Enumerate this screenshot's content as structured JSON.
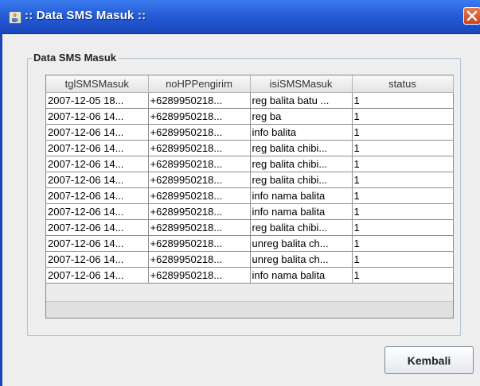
{
  "window": {
    "title": ":: Data SMS Masuk ::",
    "colors": {
      "titlebar": "#2a5fd8",
      "close_button": "#d9532c",
      "background": "#eeeeee"
    }
  },
  "group": {
    "label": "Data SMS Masuk"
  },
  "table": {
    "columns": [
      "tglSMSMasuk",
      "noHPPengirim",
      "isiSMSMasuk",
      "status"
    ],
    "rows": [
      [
        "2007-12-05 18...",
        "+6289950218...",
        "reg balita batu ...",
        "1"
      ],
      [
        "2007-12-06 14...",
        "+6289950218...",
        "reg ba",
        "1"
      ],
      [
        "2007-12-06 14...",
        "+6289950218...",
        "info balita",
        "1"
      ],
      [
        "2007-12-06 14...",
        "+6289950218...",
        "reg balita chibi...",
        "1"
      ],
      [
        "2007-12-06 14...",
        "+6289950218...",
        "reg balita chibi...",
        "1"
      ],
      [
        "2007-12-06 14...",
        "+6289950218...",
        "reg balita chibi...",
        "1"
      ],
      [
        "2007-12-06 14...",
        "+6289950218...",
        "info nama balita",
        "1"
      ],
      [
        "2007-12-06 14...",
        "+6289950218...",
        "info nama balita",
        "1"
      ],
      [
        "2007-12-06 14...",
        "+6289950218...",
        "reg balita chibi...",
        "1"
      ],
      [
        "2007-12-06 14...",
        "+6289950218...",
        "unreg balita ch...",
        "1"
      ],
      [
        "2007-12-06 14...",
        "+6289950218...",
        "unreg balita ch...",
        "1"
      ],
      [
        "2007-12-06 14...",
        "+6289950218...",
        "info nama balita",
        "1"
      ]
    ]
  },
  "buttons": {
    "back_label": "Kembali"
  },
  "icons": {
    "app": "java-cup-icon",
    "close": "close-icon"
  }
}
